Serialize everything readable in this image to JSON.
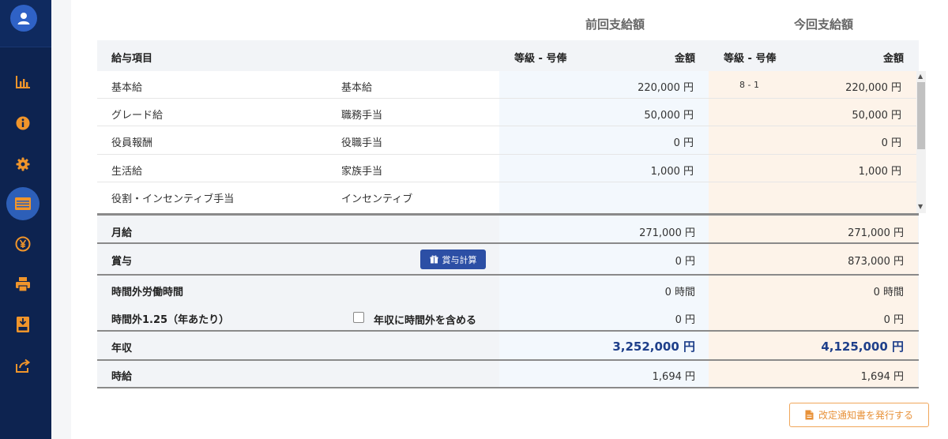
{
  "sidebar": {
    "icons": [
      "user-icon",
      "bar-chart-icon",
      "info-icon",
      "gear-icon",
      "payroll-list-icon",
      "yen-icon",
      "printer-icon",
      "csv-download-icon",
      "share-icon"
    ],
    "active": "payroll-list-icon",
    "colors": {
      "bg": "#0d2350",
      "accent": "#f0952b",
      "active": "#2d5fb8"
    }
  },
  "columns": {
    "previous": "前回支給額",
    "current": "今回支給額"
  },
  "header": {
    "item": "給与項目",
    "grade_prev": "等級 - 号俸",
    "amount_prev": "金額",
    "grade_curr": "等級 - 号俸",
    "amount_curr": "金額"
  },
  "rows": [
    {
      "item": "基本給",
      "sub": "基本給",
      "prev": "220,000 円",
      "grade": "8 - 1",
      "curr": "220,000 円"
    },
    {
      "item": "グレード給",
      "sub": "職務手当",
      "prev": "50,000 円",
      "grade": "",
      "curr": "50,000 円"
    },
    {
      "item": "役員報酬",
      "sub": "役職手当",
      "prev": "0 円",
      "grade": "",
      "curr": "0 円"
    },
    {
      "item": "生活給",
      "sub": "家族手当",
      "prev": "1,000 円",
      "grade": "",
      "curr": "1,000 円"
    },
    {
      "item": "役割・インセンティブ手当",
      "sub": "インセンティブ",
      "prev": "",
      "grade": "",
      "curr": ""
    }
  ],
  "summary": {
    "monthly": {
      "label": "月給",
      "prev": "271,000 円",
      "curr": "271,000 円"
    },
    "bonus": {
      "label": "賞与",
      "button": "賞与計算",
      "prev": "0 円",
      "curr": "873,000 円"
    },
    "overtime_hours": {
      "label": "時間外労働時間",
      "prev": "0 時間",
      "curr": "0 時間"
    },
    "overtime_rate": {
      "label": "時間外1.25（年あたり）",
      "checkbox_label": "年収に時間外を含める",
      "prev": "0 円",
      "curr": "0 円"
    },
    "annual": {
      "label": "年収",
      "prev": "3,252,000 円",
      "curr": "4,125,000 円"
    },
    "hourly": {
      "label": "時給",
      "prev": "1,694 円",
      "curr": "1,694 円"
    }
  },
  "actions": {
    "issue_notice": "改定通知書を発行する"
  }
}
